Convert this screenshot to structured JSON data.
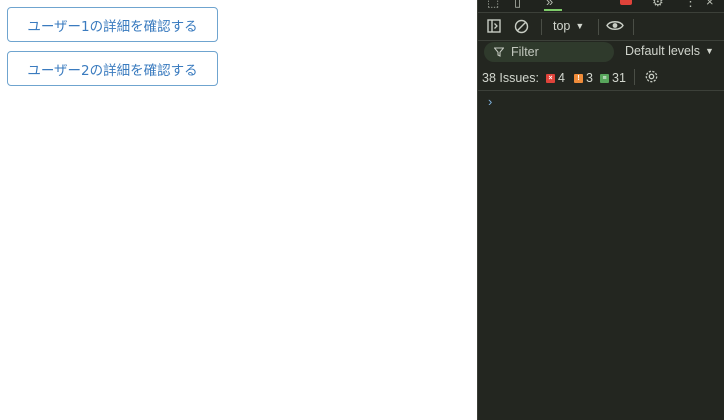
{
  "page": {
    "buttons": [
      {
        "label": "ユーザー1の詳細を確認する"
      },
      {
        "label": "ユーザー2の詳細を確認する"
      }
    ]
  },
  "devtools": {
    "toolbar": {
      "context_label": "top"
    },
    "filter": {
      "placeholder": "Filter",
      "levels_label": "Default levels"
    },
    "issues": {
      "label": "38 Issues:",
      "errors": "4",
      "warnings": "3",
      "info": "31"
    },
    "console": {
      "prompt_symbol": "›"
    },
    "colors": {
      "error": "#e0433a",
      "warning": "#f08c3a",
      "info": "#58a65c",
      "accent": "#7fcc6a"
    }
  }
}
